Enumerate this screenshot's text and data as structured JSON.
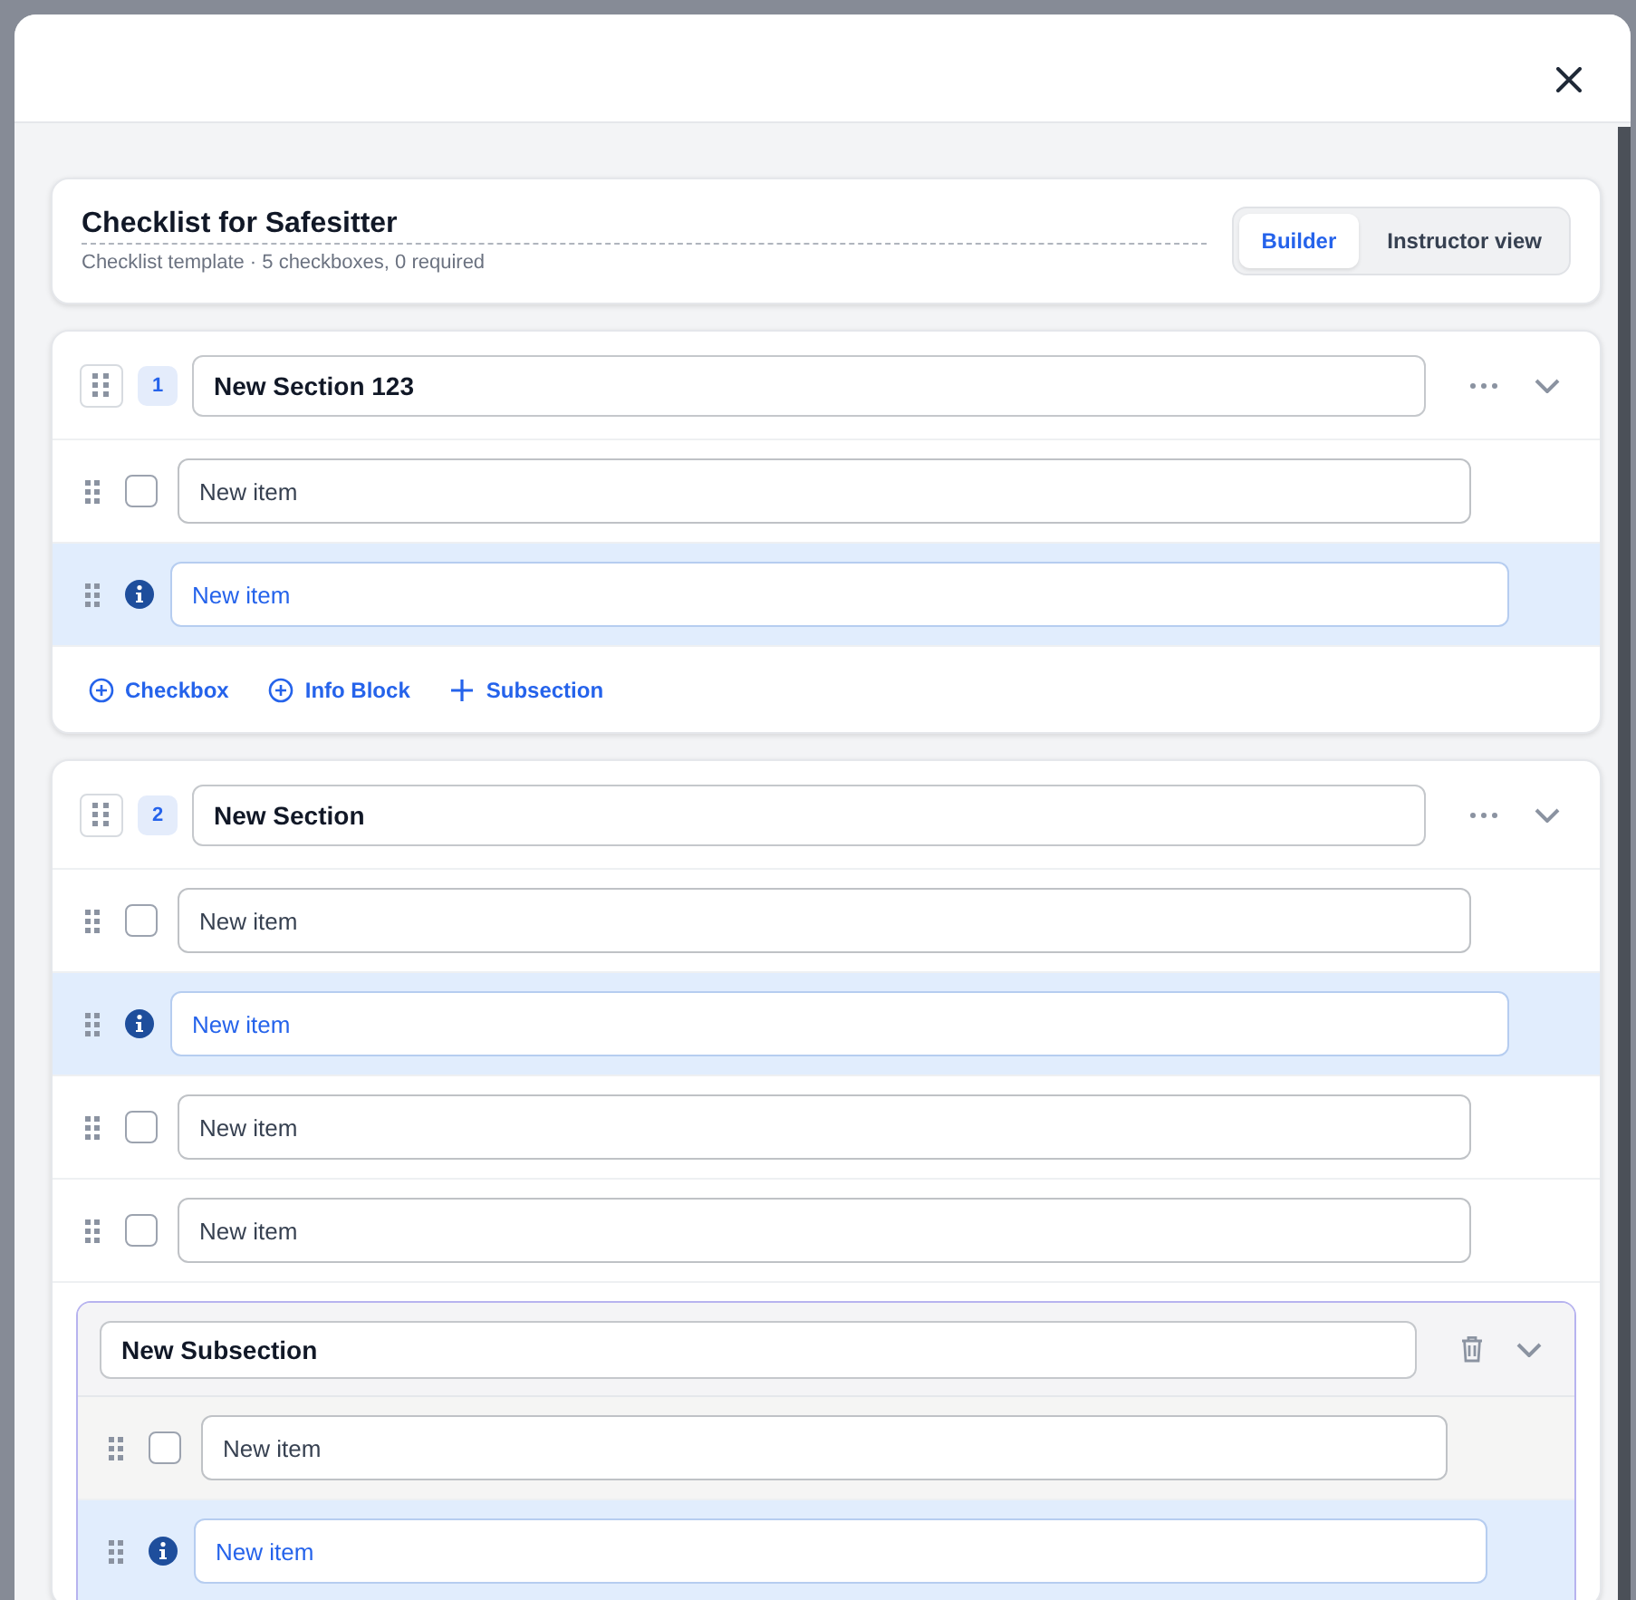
{
  "header": {
    "title": "Checklist for Safesitter",
    "subtitle": "Checklist template · 5 checkboxes, 0 required"
  },
  "view_tabs": [
    {
      "label": "Builder",
      "selected": true
    },
    {
      "label": "Instructor view",
      "selected": false
    }
  ],
  "sections": [
    {
      "number": "1",
      "title": "New Section 123",
      "items": [
        {
          "kind": "checkbox",
          "value": "New item",
          "checked": false
        },
        {
          "kind": "info",
          "value": "New item"
        }
      ],
      "add_actions": [
        {
          "kind": "circle-plus",
          "label": "Checkbox"
        },
        {
          "kind": "circle-plus",
          "label": "Info Block"
        },
        {
          "kind": "plus",
          "label": "Subsection"
        }
      ]
    },
    {
      "number": "2",
      "title": "New Section",
      "items": [
        {
          "kind": "checkbox",
          "value": "New item",
          "checked": false
        },
        {
          "kind": "info",
          "value": "New item"
        },
        {
          "kind": "checkbox",
          "value": "New item",
          "checked": false
        },
        {
          "kind": "checkbox",
          "value": "New item",
          "checked": false
        }
      ],
      "subsections": [
        {
          "title": "New Subsection",
          "items": [
            {
              "kind": "checkbox",
              "value": "New item",
              "checked": false
            },
            {
              "kind": "info",
              "value": "New item"
            }
          ]
        }
      ]
    }
  ]
}
